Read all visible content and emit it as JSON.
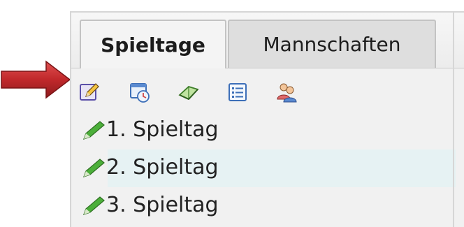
{
  "tabs": {
    "active_label": "Spieltage",
    "inactive_label": "Mannschaften"
  },
  "toolbar": {
    "icons": [
      "edit-icon",
      "schedule-icon",
      "book-icon",
      "list-icon",
      "users-icon"
    ]
  },
  "list": {
    "items": [
      {
        "label": "1. Spieltag"
      },
      {
        "label": "2. Spieltag"
      },
      {
        "label": "3. Spieltag"
      }
    ]
  },
  "colors": {
    "arrow": "#c0282b",
    "highlight": "#e6f2f3",
    "pencil": "#3a9a2a"
  }
}
